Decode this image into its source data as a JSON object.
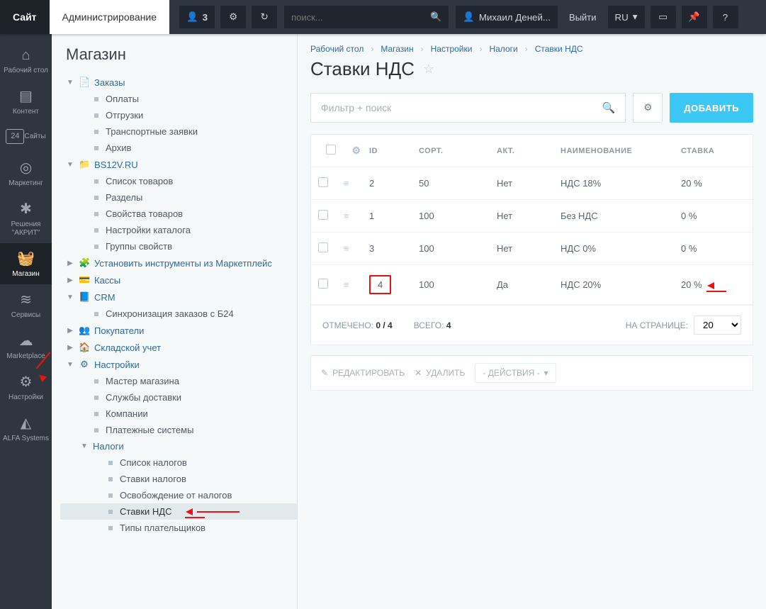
{
  "topbar": {
    "site": "Сайт",
    "admin": "Администрирование",
    "notif_label": "3",
    "search_placeholder": "поиск...",
    "user": "Михаил Деней...",
    "logout": "Выйти",
    "lang": "RU"
  },
  "rail": [
    {
      "icon": "⌂",
      "label": "Рабочий стол"
    },
    {
      "icon": "▤",
      "label": "Контент"
    },
    {
      "icon": "24",
      "label": "Сайты",
      "boxed": true
    },
    {
      "icon": "◎",
      "label": "Маркетинг"
    },
    {
      "icon": "✱",
      "label": "Решения \"АКРИТ\""
    },
    {
      "icon": "🧺",
      "label": "Магазин",
      "active": true
    },
    {
      "icon": "≋",
      "label": "Сервисы"
    },
    {
      "icon": "☁",
      "label": "Marketplace"
    },
    {
      "icon": "⚙",
      "label": "Настройки"
    },
    {
      "icon": "◭",
      "label": "ALFA Systems"
    }
  ],
  "tree": {
    "title": "Магазин",
    "nodes": [
      {
        "lvl": 1,
        "t": "▼",
        "i": "📄",
        "label": "Заказы"
      },
      {
        "lvl": 2,
        "b": true,
        "label": "Оплаты"
      },
      {
        "lvl": 2,
        "b": true,
        "label": "Отгрузки"
      },
      {
        "lvl": 2,
        "b": true,
        "label": "Транспортные заявки"
      },
      {
        "lvl": 2,
        "b": true,
        "label": "Архив"
      },
      {
        "lvl": 1,
        "t": "▼",
        "i": "📁",
        "label": "BS12V.RU"
      },
      {
        "lvl": 2,
        "b": true,
        "label": "Список товаров"
      },
      {
        "lvl": 2,
        "b": true,
        "label": "Разделы"
      },
      {
        "lvl": 2,
        "b": true,
        "label": "Свойства товаров"
      },
      {
        "lvl": 2,
        "b": true,
        "label": "Настройки каталога"
      },
      {
        "lvl": 2,
        "b": true,
        "label": "Группы свойств"
      },
      {
        "lvl": 1,
        "t": "▶",
        "i": "🧩",
        "label": "Установить инструменты из Маркетплейс"
      },
      {
        "lvl": 1,
        "t": "▶",
        "i": "💳",
        "label": "Кассы"
      },
      {
        "lvl": 1,
        "t": "▼",
        "i": "📘",
        "label": "CRM"
      },
      {
        "lvl": 2,
        "b": true,
        "label": "Синхронизация заказов с Б24"
      },
      {
        "lvl": 1,
        "t": "▶",
        "i": "👥",
        "label": "Покупатели"
      },
      {
        "lvl": 1,
        "t": "▶",
        "i": "🏠",
        "label": "Складской учет"
      },
      {
        "lvl": 1,
        "t": "▼",
        "i": "⚙",
        "label": "Настройки"
      },
      {
        "lvl": 2,
        "b": true,
        "label": "Мастер магазина"
      },
      {
        "lvl": 2,
        "b": true,
        "label": "Службы доставки"
      },
      {
        "lvl": 2,
        "b": true,
        "label": "Компании"
      },
      {
        "lvl": 2,
        "b": true,
        "label": "Платежные системы"
      },
      {
        "lvl": 2,
        "t": "▼",
        "label": "Налоги"
      },
      {
        "lvl": 3,
        "b": true,
        "label": "Список налогов"
      },
      {
        "lvl": 3,
        "b": true,
        "label": "Ставки налогов"
      },
      {
        "lvl": 3,
        "b": true,
        "label": "Освобождение от налогов"
      },
      {
        "lvl": 3,
        "b": true,
        "label": "Ставки НДС",
        "active": true,
        "arrow": true
      },
      {
        "lvl": 3,
        "b": true,
        "label": "Типы плательщиков"
      }
    ]
  },
  "breadcrumbs": [
    "Рабочий стол",
    "Магазин",
    "Настройки",
    "Налоги",
    "Ставки НДС"
  ],
  "page_title": "Ставки НДС",
  "filter_placeholder": "Фильтр + поиск",
  "add_button": "ДОБАВИТЬ",
  "table": {
    "headers": {
      "id": "ID",
      "sort": "СОРТ.",
      "act": "АКТ.",
      "name": "НАИМЕНОВАНИЕ",
      "rate": "СТАВКА"
    },
    "rows": [
      {
        "id": "2",
        "sort": "50",
        "act": "Нет",
        "name": "НДС 18%",
        "rate": "20 %"
      },
      {
        "id": "1",
        "sort": "100",
        "act": "Нет",
        "name": "Без НДС",
        "rate": "0 %"
      },
      {
        "id": "3",
        "sort": "100",
        "act": "Нет",
        "name": "НДС 0%",
        "rate": "0 %"
      },
      {
        "id": "4",
        "sort": "100",
        "act": "Да",
        "name": "НДС 20%",
        "rate": "20 %",
        "hl": true,
        "arrow": true
      }
    ],
    "footer": {
      "selected_label": "ОТМЕЧЕНО:",
      "selected": "0 / 4",
      "total_label": "ВСЕГО:",
      "total": "4",
      "perpage_label": "НА СТРАНИЦЕ:",
      "perpage": "20"
    }
  },
  "actions": {
    "edit": "РЕДАКТИРОВАТЬ",
    "delete": "УДАЛИТЬ",
    "dropdown": "- ДЕЙСТВИЯ -"
  }
}
